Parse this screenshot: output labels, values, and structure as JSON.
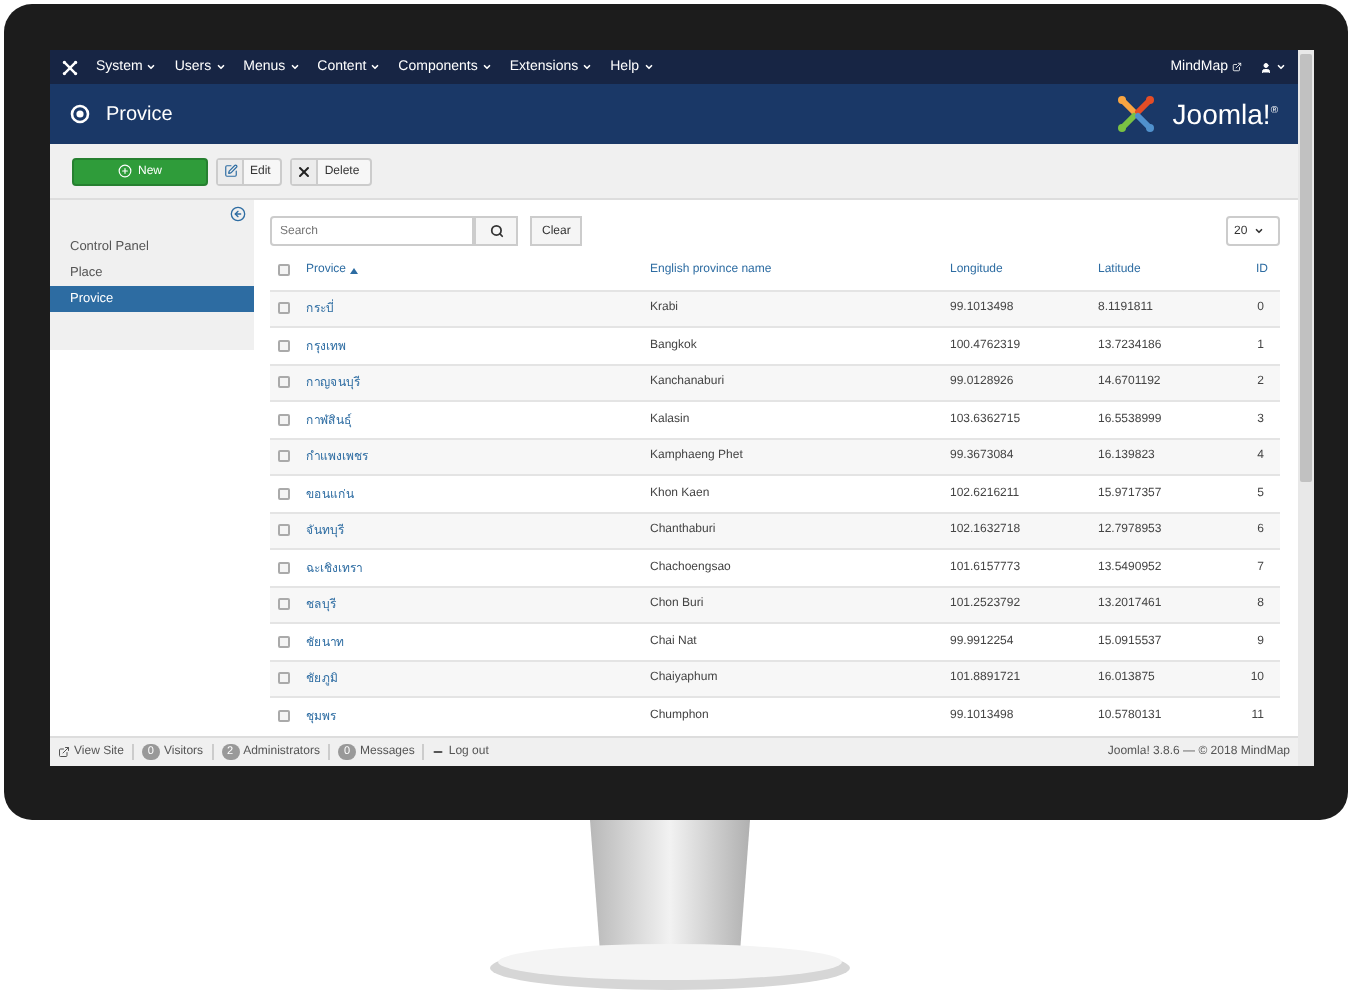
{
  "top_menu": [
    {
      "label": "System"
    },
    {
      "label": "Users"
    },
    {
      "label": "Menus"
    },
    {
      "label": "Content"
    },
    {
      "label": "Components"
    },
    {
      "label": "Extensions"
    },
    {
      "label": "Help"
    }
  ],
  "site_link": "MindMap",
  "page_title": "Provice",
  "logo_text": "Joomla!$^{®}$",
  "toolbar": [
    {
      "label": "New",
      "kind": "new"
    },
    {
      "label": "Edit",
      "kind": "edit"
    },
    {
      "label": "Delete",
      "kind": "delete"
    }
  ],
  "sidebar": {
    "items": [
      {
        "label": "Control Panel",
        "selected": false
      },
      {
        "label": "Place",
        "selected": false
      },
      {
        "label": "Provice",
        "selected": true
      }
    ]
  },
  "search": {
    "placeholder": "Search",
    "clear": "Clear"
  },
  "list_limit": "20",
  "table": {
    "select_all_checked": false,
    "columns": [
      {
        "label": "Provice",
        "sorted": true
      },
      {
        "label": "English province name",
        "sorted": false
      },
      {
        "label": "Longitude",
        "sorted": false
      },
      {
        "label": "Latitude",
        "sorted": false
      },
      {
        "label": "ID",
        "sorted": false
      }
    ],
    "rows": [
      {
        "checked": false,
        "cells": [
          "กระบี่",
          "Krabi",
          "99.1013498",
          "8.1191811",
          "0"
        ]
      },
      {
        "checked": false,
        "cells": [
          "กรุงเทพ",
          "Bangkok",
          "100.4762319",
          "13.7234186",
          "1"
        ]
      },
      {
        "checked": false,
        "cells": [
          "กาญจนบุรี",
          "Kanchanaburi",
          "99.0128926",
          "14.6701192",
          "2"
        ]
      },
      {
        "checked": false,
        "cells": [
          "กาฬสินธุ์",
          "Kalasin",
          "103.6362715",
          "16.5538999",
          "3"
        ]
      },
      {
        "checked": false,
        "cells": [
          "กำแพงเพชร",
          "Kamphaeng Phet",
          "99.3673084",
          "16.139823",
          "4"
        ]
      },
      {
        "checked": false,
        "cells": [
          "ขอนแก่น",
          "Khon Kaen",
          "102.6216211",
          "15.9717357",
          "5"
        ]
      },
      {
        "checked": false,
        "cells": [
          "จันทบุรี",
          "Chanthaburi",
          "102.1632718",
          "12.7978953",
          "6"
        ]
      },
      {
        "checked": false,
        "cells": [
          "ฉะเชิงเทรา",
          "Chachoengsao",
          "101.6157773",
          "13.5490952",
          "7"
        ]
      },
      {
        "checked": false,
        "cells": [
          "ชลบุรี",
          "Chon Buri",
          "101.2523792",
          "13.2017461",
          "8"
        ]
      },
      {
        "checked": false,
        "cells": [
          "ชัยนาท",
          "Chai Nat",
          "99.9912254",
          "15.0915537",
          "9"
        ]
      },
      {
        "checked": false,
        "cells": [
          "ชัยภูมิ",
          "Chaiyaphum",
          "101.8891721",
          "16.013875",
          "10"
        ]
      },
      {
        "checked": false,
        "cells": [
          "ชุมพร",
          "Chumphon",
          "99.1013498",
          "10.5780131",
          "11"
        ]
      }
    ]
  },
  "status_bar": {
    "items": [
      {
        "kind": "link",
        "label": "View Site"
      },
      {
        "kind": "count",
        "count": "0",
        "label": "Visitors"
      },
      {
        "kind": "count",
        "count": "2",
        "label": "Administrators"
      },
      {
        "kind": "count",
        "count": "0",
        "label": "Messages"
      },
      {
        "kind": "logout",
        "label": "Log out"
      }
    ],
    "version": "Joomla! 3.8.6 — © 2018 MindMap"
  }
}
